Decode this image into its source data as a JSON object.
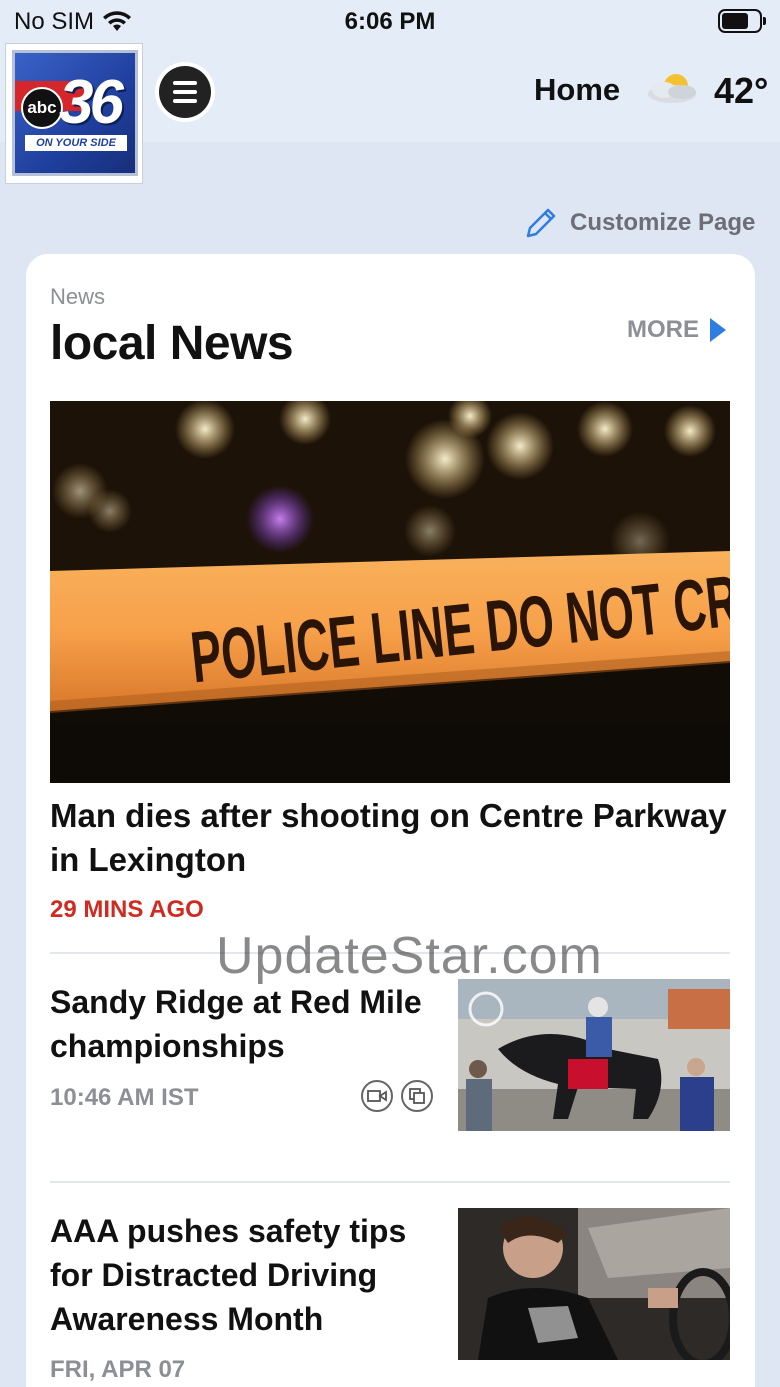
{
  "status_bar": {
    "carrier": "No SIM",
    "time": "6:06 PM"
  },
  "header": {
    "logo": {
      "brand": "abc",
      "channel_number": "36",
      "tagline": "ON YOUR SIDE"
    },
    "menu_icon": "hamburger-menu-icon",
    "nav_label": "Home",
    "weather_icon": "partly-cloudy-icon",
    "temperature": "42°"
  },
  "customize": {
    "label": "Customize Page",
    "icon": "pencil-icon"
  },
  "section": {
    "kicker": "News",
    "title": "local News",
    "more_label": "MORE"
  },
  "hero_story": {
    "image_caption_text": "POLICE LINE DO NOT CROSS",
    "title": "Man dies after shooting on Centre Parkway in Lexington",
    "time": "29 MINS AGO"
  },
  "stories": [
    {
      "title": "Sandy Ridge at Red Mile championships",
      "time": "10:46 AM IST",
      "icons": [
        "video-icon",
        "gallery-icon"
      ]
    },
    {
      "title": "AAA pushes safety tips for Distracted Driving Awareness Month",
      "time": "FRI, APR 07"
    }
  ],
  "watermark": "UpdateStar.com",
  "colors": {
    "accent_blue": "#2f7de1",
    "timestamp_red": "#d02b20",
    "background": "#dde6f2"
  }
}
